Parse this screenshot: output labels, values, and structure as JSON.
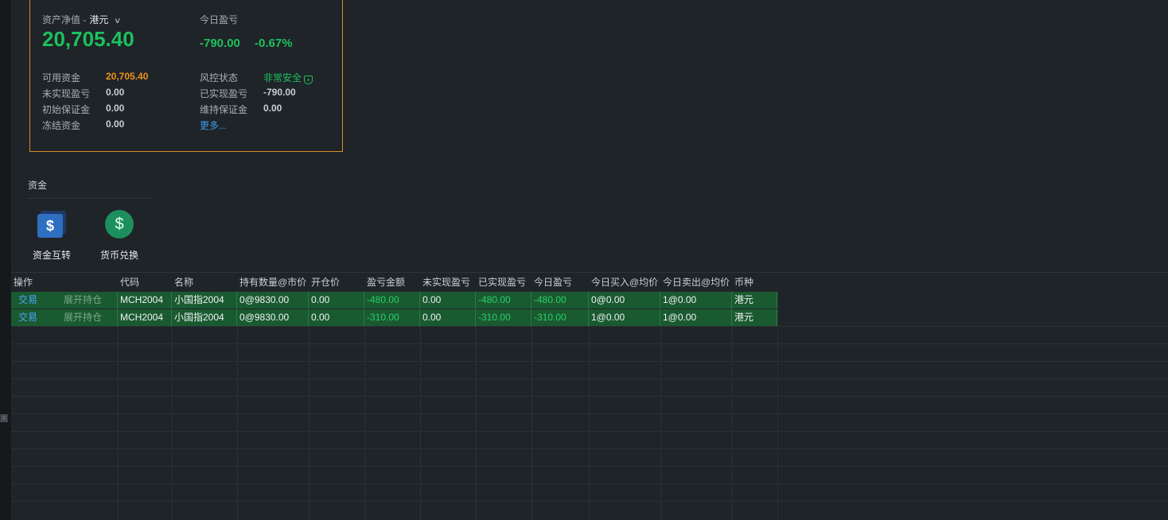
{
  "account": {
    "nav_label": "资产净值 -",
    "currency": "港元",
    "nav_value": "20,705.40",
    "today_pnl_label": "今日盈亏",
    "today_pnl": "-790.00",
    "today_pnl_pct": "-0.67%",
    "left_fields": [
      {
        "label": "可用资金",
        "value": "20,705.40"
      },
      {
        "label": "未实现盈亏",
        "value": "0.00"
      },
      {
        "label": "初始保证金",
        "value": "0.00"
      },
      {
        "label": "冻结资金",
        "value": "0.00"
      }
    ],
    "right_fields": [
      {
        "label": "风控状态",
        "value": "非常安全"
      },
      {
        "label": "已实现盈亏",
        "value": "-790.00"
      },
      {
        "label": "维持保证金",
        "value": "0.00"
      }
    ],
    "more_link": "更多..."
  },
  "funds": {
    "title": "资金",
    "items": [
      {
        "label": "资金互转",
        "icon": "dollar-transfer-icon"
      },
      {
        "label": "货币兑换",
        "icon": "currency-exchange-icon"
      }
    ]
  },
  "table": {
    "headers": [
      "操作",
      "代码",
      "名称",
      "持有数量@市价",
      "开仓价",
      "盈亏金额",
      "未实现盈亏",
      "已实现盈亏",
      "今日盈亏",
      "今日买入@均价",
      "今日卖出@均价",
      "币种"
    ],
    "rows": [
      {
        "trade": "交易",
        "expand": "展开持仓",
        "code": "MCH2004",
        "name": "小国指2004",
        "qty": "0@9830.00",
        "open": "0.00",
        "pnl": "-480.00",
        "unrealized": "0.00",
        "realized": "-480.00",
        "today": "-480.00",
        "buy": "0@0.00",
        "sell": "1@0.00",
        "currency": "港元"
      },
      {
        "trade": "交易",
        "expand": "展开持仓",
        "code": "MCH2004",
        "name": "小国指2004",
        "qty": "0@9830.00",
        "open": "0.00",
        "pnl": "-310.00",
        "unrealized": "0.00",
        "realized": "-310.00",
        "today": "-310.00",
        "buy": "1@0.00",
        "sell": "1@0.00",
        "currency": "港元"
      }
    ]
  },
  "colors": {
    "profit_green": "#1cc15e",
    "accent_orange": "#f0921e",
    "link_blue": "#3e9bf0",
    "row_bg": "#1a5a30"
  },
  "side_glyph": "園"
}
